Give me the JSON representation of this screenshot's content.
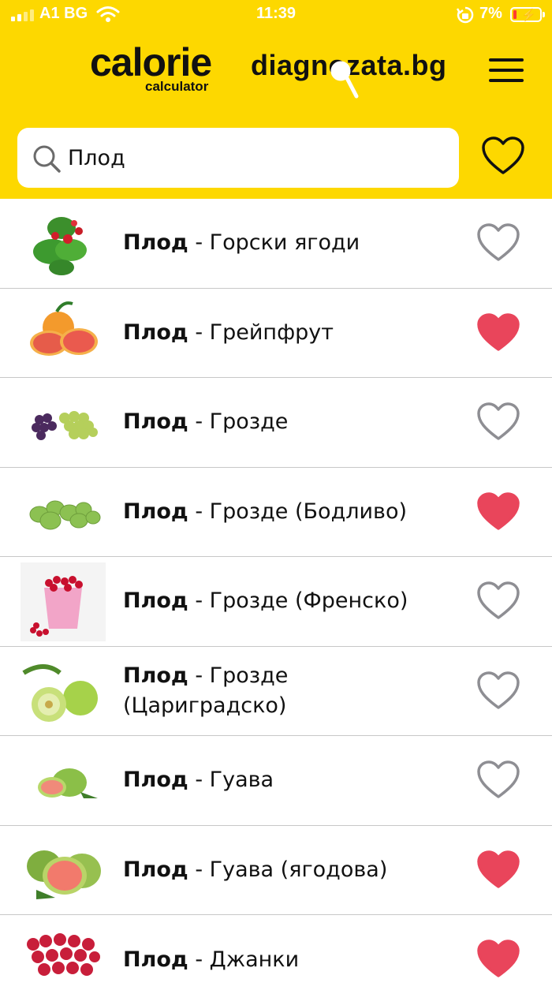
{
  "status_bar": {
    "carrier": "A1 BG",
    "time": "11:39",
    "battery": "7%"
  },
  "header": {
    "logo_left": {
      "word": "calorie",
      "sub": "calculator"
    },
    "logo_right": "diagnozata.bg",
    "background_color": "#FDD800"
  },
  "search": {
    "value": "Плод",
    "placeholder": ""
  },
  "list": [
    {
      "category": "Плод",
      "separator": " - ",
      "name": "Горски ягоди",
      "favorite": false,
      "thumb": "wild-strawberry"
    },
    {
      "category": "Плод",
      "separator": " - ",
      "name": "Грейпфрут",
      "favorite": true,
      "thumb": "grapefruit"
    },
    {
      "category": "Плод",
      "separator": " - ",
      "name": "Грозде",
      "favorite": false,
      "thumb": "grapes"
    },
    {
      "category": "Плод",
      "separator": " - ",
      "name": "Грозде (Бодливо)",
      "favorite": true,
      "thumb": "gooseberry"
    },
    {
      "category": "Плод",
      "separator": " - ",
      "name": "Грозде (Френско)",
      "favorite": false,
      "thumb": "redcurrant"
    },
    {
      "category": "Плод",
      "separator": " - ",
      "name": "Грозде (Цариградско)",
      "favorite": false,
      "thumb": "amla"
    },
    {
      "category": "Плод",
      "separator": " - ",
      "name": "Гуава",
      "favorite": false,
      "thumb": "guava"
    },
    {
      "category": "Плод",
      "separator": " - ",
      "name": "Гуава (ягодова)",
      "favorite": true,
      "thumb": "strawberry-guava"
    },
    {
      "category": "Плод",
      "separator": " - ",
      "name": "Джанки",
      "favorite": true,
      "thumb": "cherry-plum"
    }
  ],
  "colors": {
    "heart_filled": "#E9455B",
    "heart_outline": "#8E8E93"
  }
}
